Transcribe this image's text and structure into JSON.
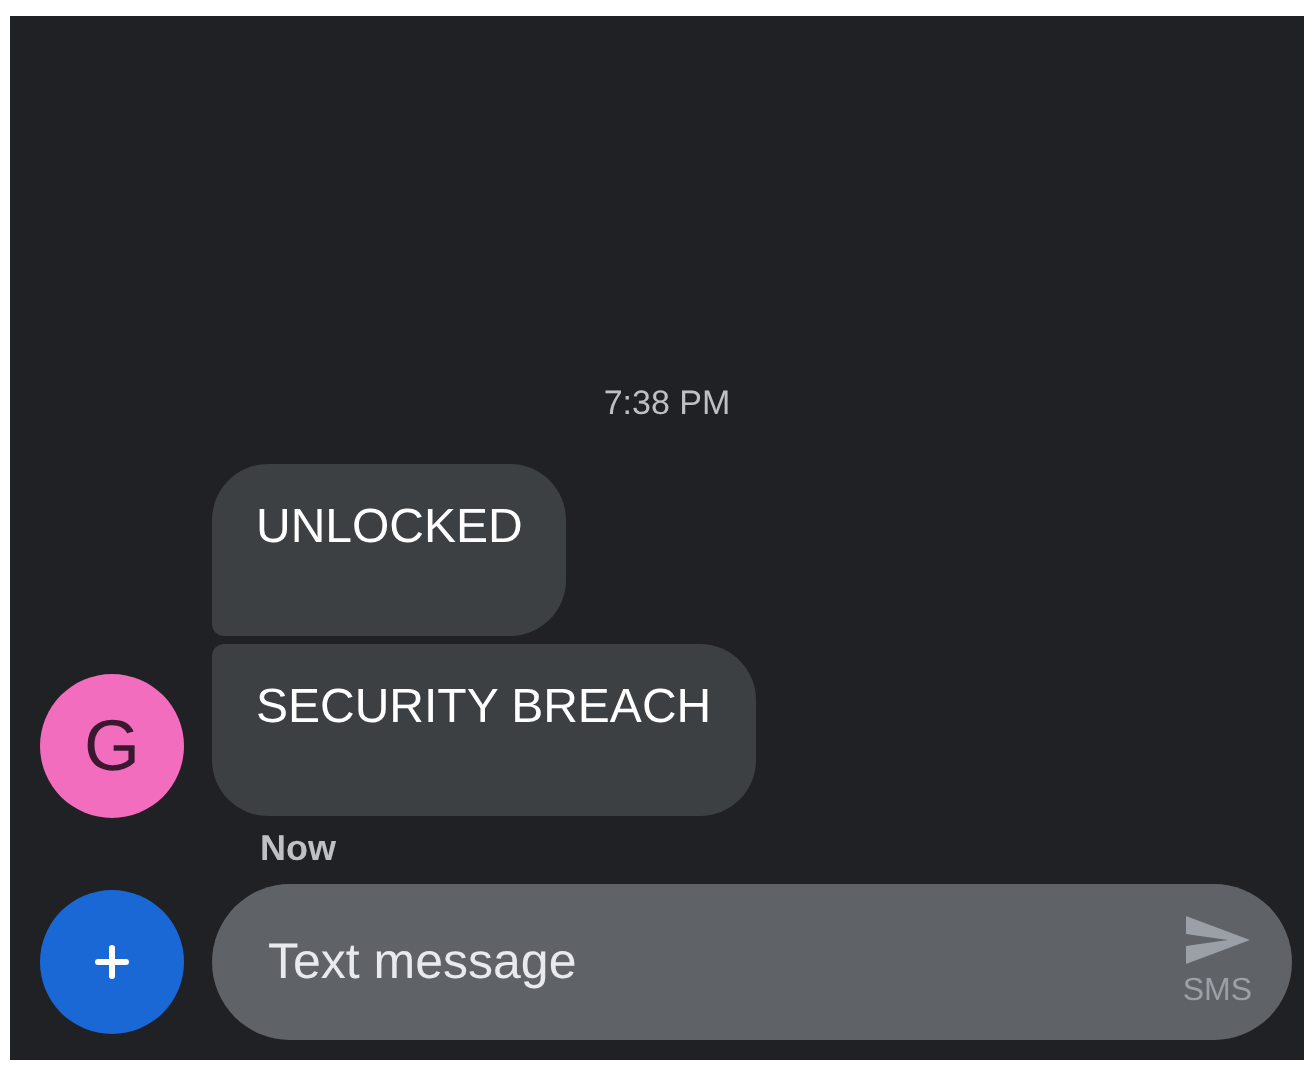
{
  "timestamp": "7:38 PM",
  "sender": {
    "initial": "G",
    "color": "#f36dbf"
  },
  "messages": [
    {
      "text": "UNLOCKED"
    },
    {
      "text": "SECURITY BREACH"
    }
  ],
  "status": "Now",
  "composer": {
    "placeholder": "Text message",
    "mode": "SMS"
  }
}
